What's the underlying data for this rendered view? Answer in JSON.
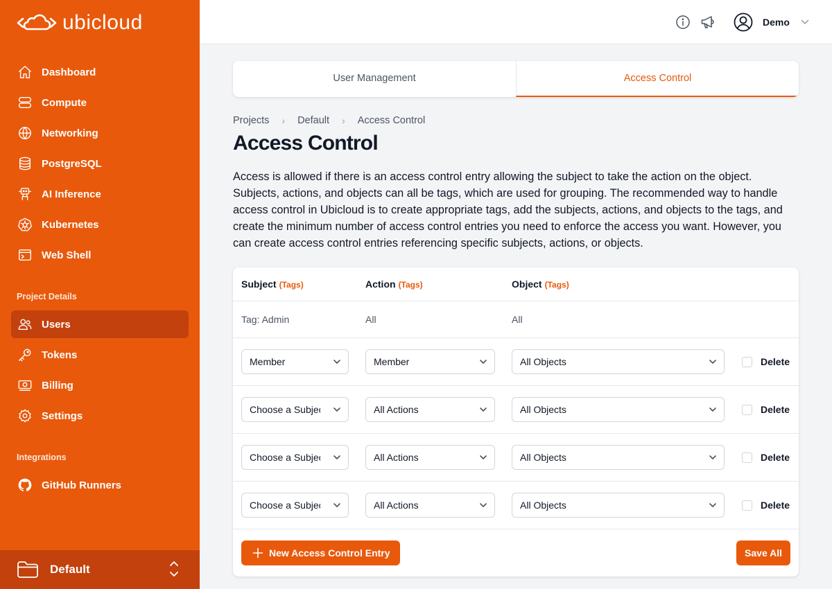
{
  "app": {
    "logo_text": "ubicloud",
    "brand_color": "#e8590c"
  },
  "sidebar": {
    "nav": [
      {
        "label": "Dashboard",
        "icon": "home-icon"
      },
      {
        "label": "Compute",
        "icon": "server-icon"
      },
      {
        "label": "Networking",
        "icon": "globe-icon"
      },
      {
        "label": "PostgreSQL",
        "icon": "database-icon"
      },
      {
        "label": "AI Inference",
        "icon": "robot-icon"
      },
      {
        "label": "Kubernetes",
        "icon": "kubernetes-icon"
      },
      {
        "label": "Web Shell",
        "icon": "terminal-icon"
      }
    ],
    "project_details_title": "Project Details",
    "project_items": [
      {
        "label": "Users",
        "icon": "users-icon",
        "active": true
      },
      {
        "label": "Tokens",
        "icon": "key-icon"
      },
      {
        "label": "Billing",
        "icon": "billing-icon"
      },
      {
        "label": "Settings",
        "icon": "gear-icon"
      }
    ],
    "integrations_title": "Integrations",
    "integration_items": [
      {
        "label": "GitHub Runners",
        "icon": "github-icon"
      }
    ],
    "project_switcher": {
      "label": "Default"
    }
  },
  "header": {
    "user_name": "Demo"
  },
  "tabs": [
    {
      "label": "User Management",
      "active": false
    },
    {
      "label": "Access Control",
      "active": true
    }
  ],
  "breadcrumb": [
    "Projects",
    "Default",
    "Access Control"
  ],
  "page": {
    "title": "Access Control",
    "description": "Access is allowed if there is an access control entry allowing the subject to take the action on the object. Subjects, actions, and objects can all be tags, which are used for grouping. The recommended way to handle access control in Ubicloud is to create appropriate tags, add the subjects, actions, and objects to the tags, and create the minimum number of access control entries you need to enforce the access you want. However, you can create access control entries referencing specific subjects, actions, or objects."
  },
  "table": {
    "headers": {
      "subject": "Subject",
      "action": "Action",
      "object": "Object",
      "tags": "(Tags)"
    },
    "fixed_row": {
      "subject": "Tag: Admin",
      "action": "All",
      "object": "All"
    },
    "rows": [
      {
        "subject": "Member",
        "action": "Member",
        "object": "All Objects",
        "delete_label": "Delete"
      },
      {
        "subject": "Choose a Subject",
        "action": "All Actions",
        "object": "All Objects",
        "delete_label": "Delete"
      },
      {
        "subject": "Choose a Subject",
        "action": "All Actions",
        "object": "All Objects",
        "delete_label": "Delete"
      },
      {
        "subject": "Choose a Subject",
        "action": "All Actions",
        "object": "All Objects",
        "delete_label": "Delete"
      }
    ],
    "new_entry_label": "New Access Control Entry",
    "save_label": "Save All"
  }
}
